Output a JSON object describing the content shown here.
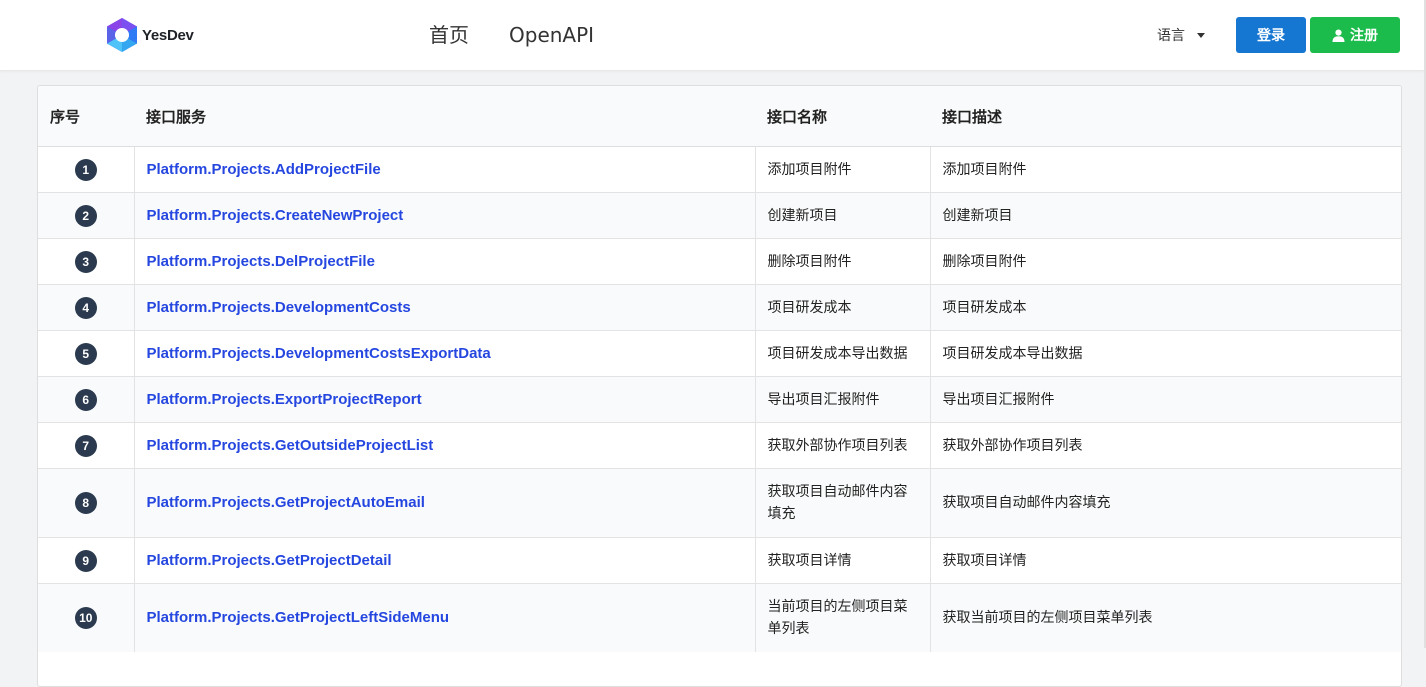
{
  "header": {
    "logo_text": "YesDev",
    "nav": [
      "首页",
      "OpenAPI"
    ],
    "language_label": "语言",
    "login_label": "登录",
    "register_label": "注册",
    "colors": {
      "login": "#1677d2",
      "register": "#1bbc4b",
      "link": "#2547e0"
    }
  },
  "table": {
    "headers": [
      "序号",
      "接口服务",
      "接口名称",
      "接口描述"
    ],
    "rows": [
      {
        "index": "1",
        "service": "Platform.Projects.AddProjectFile",
        "name": "添加项目附件",
        "desc": "添加项目附件"
      },
      {
        "index": "2",
        "service": "Platform.Projects.CreateNewProject",
        "name": "创建新项目",
        "desc": "创建新项目"
      },
      {
        "index": "3",
        "service": "Platform.Projects.DelProjectFile",
        "name": "删除项目附件",
        "desc": "删除项目附件"
      },
      {
        "index": "4",
        "service": "Platform.Projects.DevelopmentCosts",
        "name": "项目研发成本",
        "desc": "项目研发成本"
      },
      {
        "index": "5",
        "service": "Platform.Projects.DevelopmentCostsExportData",
        "name": "项目研发成本导出数据",
        "desc": "项目研发成本导出数据"
      },
      {
        "index": "6",
        "service": "Platform.Projects.ExportProjectReport",
        "name": "导出项目汇报附件",
        "desc": "导出项目汇报附件"
      },
      {
        "index": "7",
        "service": "Platform.Projects.GetOutsideProjectList",
        "name": "获取外部协作项目列表",
        "desc": "获取外部协作项目列表"
      },
      {
        "index": "8",
        "service": "Platform.Projects.GetProjectAutoEmail",
        "name": "获取项目自动邮件内容填充",
        "desc": "获取项目自动邮件内容填充"
      },
      {
        "index": "9",
        "service": "Platform.Projects.GetProjectDetail",
        "name": "获取项目详情",
        "desc": "获取项目详情"
      },
      {
        "index": "10",
        "service": "Platform.Projects.GetProjectLeftSideMenu",
        "name": "当前项目的左侧项目菜单列表",
        "desc": "获取当前项目的左侧项目菜单列表"
      }
    ]
  }
}
